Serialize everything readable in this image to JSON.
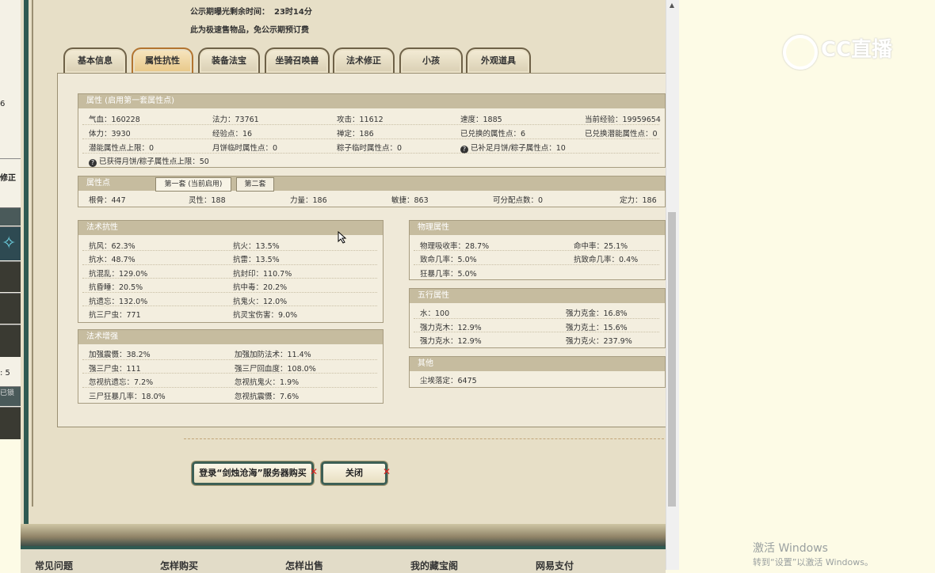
{
  "left_strip": {
    "num": "6",
    "label1": "修正",
    "label2": ": 5",
    "label3": "已锁"
  },
  "header": {
    "remaining_label": "公示期曝光剩余时间：",
    "remaining_value": "23时14分",
    "notice": "此为极速售物品，免公示期预订费"
  },
  "tabs": [
    "基本信息",
    "属性抗性",
    "装备法宝",
    "坐骑召唤兽",
    "法术修正",
    "小孩",
    "外观道具"
  ],
  "active_tab": "属性抗性",
  "attr": {
    "title": "属性 (启用第一套属性点)",
    "rows": [
      [
        "气血：160228",
        "法力：73761",
        "攻击：11612",
        "速度：1885",
        "当前经验：19959654"
      ],
      [
        "体力：3930",
        "经验点：16",
        "禅定：186",
        "已兑换的属性点：6",
        "已兑换潜能属性点：0"
      ],
      [
        "潜能属性点上限：0",
        "月饼临时属性点：0",
        "粽子临时属性点：0",
        "已补足月饼/粽子属性点：10"
      ]
    ],
    "note": "已获得月饼/粽子属性点上限：50"
  },
  "points": {
    "title": "属性点",
    "tab1": "第一套 (当前启用)",
    "tab2": "第二套",
    "row": [
      "根骨：447",
      "灵性：188",
      "力量：186",
      "敏捷：863",
      "可分配点数：0",
      "定力：186"
    ]
  },
  "spell_resist": {
    "title": "法术抗性",
    "left": [
      "抗风：62.3%",
      "抗水：48.7%",
      "抗混乱：129.0%",
      "抗昏睡：20.5%",
      "抗遗忘：132.0%",
      "抗三尸虫：771"
    ],
    "right": [
      "抗火：13.5%",
      "抗雷：13.5%",
      "抗封印：110.7%",
      "抗中毒：20.2%",
      "抗鬼火：12.0%",
      "抗灵宝伤害：9.0%"
    ]
  },
  "spell_boost": {
    "title": "法术增强",
    "left": [
      "加强震慑：38.2%",
      "强三尸虫：111",
      "忽视抗遗忘：7.2%",
      "三尸狂暴几率：18.0%"
    ],
    "right": [
      "加强加防法术：11.4%",
      "强三尸回血度：108.0%",
      "忽视抗鬼火：1.9%",
      "忽视抗震慑：7.6%"
    ]
  },
  "physical": {
    "title": "物理属性",
    "left": [
      "物理吸收率：28.7%",
      "致命几率：5.0%",
      "狂暴几率：5.0%"
    ],
    "right": [
      "命中率：25.1%",
      "抗致命几率：0.4%"
    ]
  },
  "elements": {
    "title": "五行属性",
    "left": [
      "水：100",
      "强力克木：12.9%",
      "强力克水：12.9%"
    ],
    "right": [
      "强力克金：16.8%",
      "强力克土：15.6%",
      "强力克火：237.9%"
    ]
  },
  "other": {
    "title": "其他",
    "items": [
      "尘埃落定：6475"
    ]
  },
  "buttons": {
    "buy": "登录“剑烛沧海”服务器购买",
    "close": "关闭"
  },
  "nav": [
    "常见问题",
    "怎样购买",
    "怎样出售",
    "我的藏宝阁",
    "网易支付"
  ],
  "overlay": {
    "logo": "CC直播",
    "activate_title": "激活 Windows",
    "activate_sub": "转到“设置”以激活 Windows。"
  }
}
